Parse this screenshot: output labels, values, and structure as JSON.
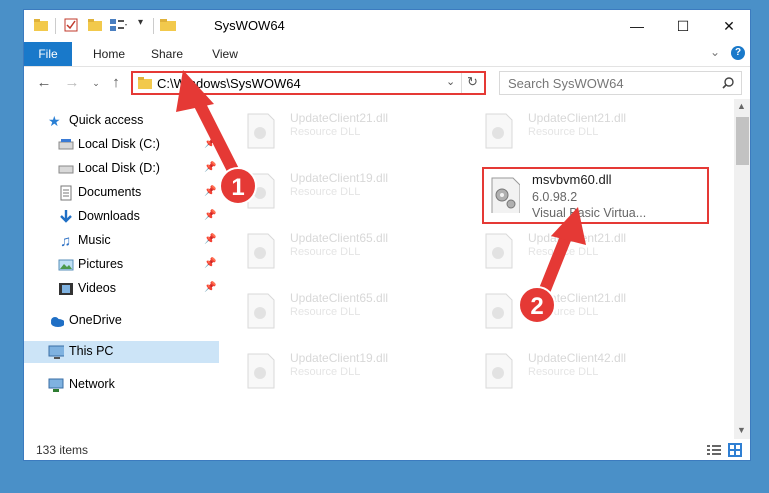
{
  "window": {
    "title": "SysWOW64"
  },
  "ribbon": {
    "tabs": [
      "File",
      "Home",
      "Share",
      "View"
    ]
  },
  "nav": {
    "address": "C:\\Windows\\SysWOW64",
    "search_placeholder": "Search SysWOW64"
  },
  "sidebar": {
    "quick_access": "Quick access",
    "items": [
      "Local Disk (C:)",
      "Local Disk (D:)",
      "Documents",
      "Downloads",
      "Music",
      "Pictures",
      "Videos"
    ],
    "onedrive": "OneDrive",
    "thispc": "This PC",
    "network": "Network"
  },
  "files": [
    {
      "name": "UpdateClient21.dll",
      "desc": "Resource DLL"
    },
    {
      "name": "UpdateClient21.dll",
      "desc": "Resource DLL"
    },
    {
      "name": "UpdateClient19.dll",
      "desc": "Resource DLL"
    },
    {
      "name": "UpdateClient65.dll",
      "desc": "Resource DLL"
    },
    {
      "name": "UpdateClient21.dll",
      "desc": "Resource DLL"
    },
    {
      "name": "UpdateClient65.dll",
      "desc": "Resource DLL"
    },
    {
      "name": "UpdateClient21.dll",
      "desc": "Resource DLL"
    },
    {
      "name": "UpdateClient19.dll",
      "desc": "Resource DLL"
    },
    {
      "name": "UpdateClient42.dll",
      "desc": "Resource DLL"
    }
  ],
  "selected_file": {
    "name": "msvbvm60.dll",
    "version": "6.0.98.2",
    "desc": "Visual Basic Virtua..."
  },
  "status": {
    "count": "133 items"
  },
  "annotations": {
    "step1": "1",
    "step2": "2",
    "color": "#e53935"
  }
}
